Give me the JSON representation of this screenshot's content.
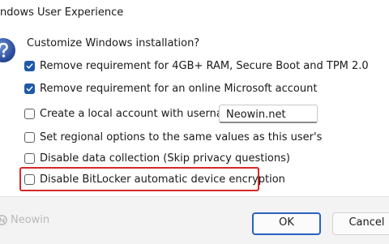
{
  "window": {
    "title": "ndows User Experience"
  },
  "dialog": {
    "heading": "Customize Windows installation?",
    "options": [
      {
        "label": "Remove requirement for 4GB+ RAM, Secure Boot and TPM 2.0",
        "checked": true
      },
      {
        "label": "Remove requirement for an online Microsoft account",
        "checked": true
      },
      {
        "label": "Create a local account with username:",
        "checked": false
      },
      {
        "label": "Set regional options to the same values as this user's",
        "checked": false
      },
      {
        "label": "Disable data collection (Skip privacy questions)",
        "checked": false
      },
      {
        "label": "Disable BitLocker automatic device encryption",
        "checked": false
      }
    ],
    "username_value": "Neowin.net"
  },
  "footer": {
    "watermark": "Neowin",
    "ok_label": "OK",
    "cancel_label": "Cancel"
  },
  "colors": {
    "accent": "#1f5aa8",
    "highlight": "#d62828",
    "footer_bg": "#f3f3f3"
  },
  "icons": {
    "dialog": "question-icon",
    "check": "checkmark-icon",
    "watermark": "neowin-logo-icon"
  }
}
